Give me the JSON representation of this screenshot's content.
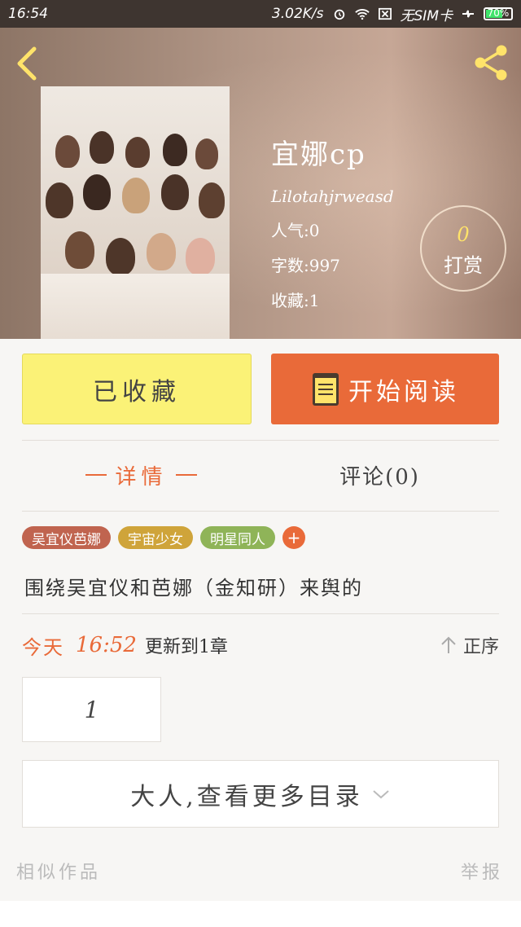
{
  "status_bar": {
    "time": "16:54",
    "speed": "3.02K/s",
    "sim": "无SIM卡",
    "battery": "70%",
    "battery_level": 0.7
  },
  "header": {
    "title": "宜娜cp",
    "author": "Lilotahjrweasd",
    "stats": [
      "人气:0",
      "字数:997",
      "收藏:1"
    ],
    "reward": {
      "count": "0",
      "label": "打赏"
    }
  },
  "actions": {
    "collected_label": "已收藏",
    "read_label": "开始阅读"
  },
  "tabs": {
    "details": "详情",
    "comments": "评论(0)"
  },
  "tags": [
    {
      "label": "吴宜仪芭娜",
      "color": "#c0644f"
    },
    {
      "label": "宇宙少女",
      "color": "#cfa43a"
    },
    {
      "label": "明星同人",
      "color": "#8fb458"
    }
  ],
  "tag_add": "+",
  "description": "围绕吴宜仪和芭娜（金知研）来舆的",
  "update": {
    "today": "今天",
    "time": "16:52",
    "text": "更新到1章",
    "sort_label": "正序"
  },
  "chapters": [
    "1"
  ],
  "more_catalog": "大人,查看更多目录",
  "footer": {
    "similar": "相似作品",
    "report": "举报"
  },
  "colors": {
    "accent": "#e96a39",
    "collected_bg": "#fbf277"
  }
}
